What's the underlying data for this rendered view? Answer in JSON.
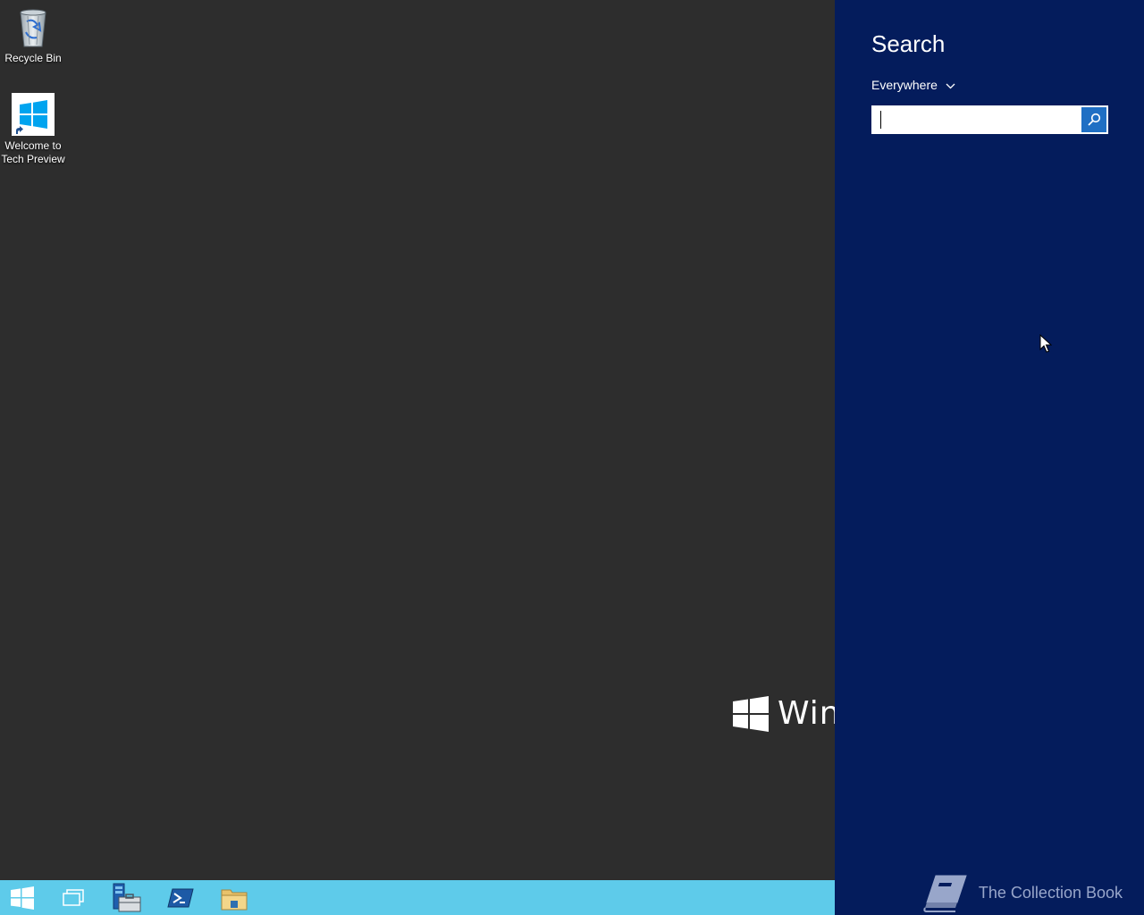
{
  "desktop": {
    "icons": [
      {
        "label": "Recycle Bin",
        "icon": "recycle-bin-icon"
      },
      {
        "label_line1": "Welcome to",
        "label_line2": "Tech Preview",
        "icon": "windows-logo-icon"
      }
    ],
    "watermark_text": "Winc"
  },
  "taskbar": {
    "items": [
      {
        "icon": "start-windows-icon"
      },
      {
        "icon": "task-view-icon"
      },
      {
        "icon": "server-manager-icon"
      },
      {
        "icon": "powershell-icon"
      },
      {
        "icon": "file-explorer-icon"
      }
    ],
    "color": "#5ecbea"
  },
  "search": {
    "title": "Search",
    "scope": "Everywhere",
    "input_value": "",
    "pane_color": "#041c5c",
    "button_color": "#1f6fc4"
  },
  "watermark": {
    "text": "The Collection Book",
    "icon": "book-icon"
  }
}
